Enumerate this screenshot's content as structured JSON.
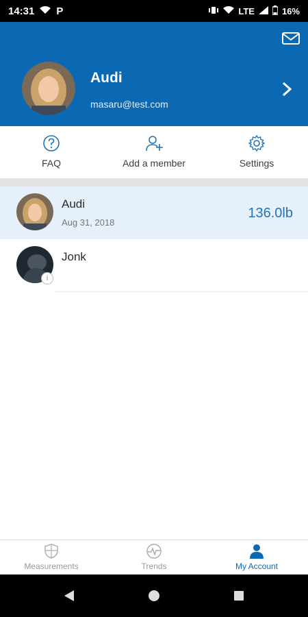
{
  "status_bar": {
    "time": "14:31",
    "network": "LTE",
    "battery": "16%",
    "p_label": "P"
  },
  "header": {
    "name": "Audi",
    "email": "masaru@test.com"
  },
  "actions": [
    {
      "label": "FAQ",
      "icon": "help-circle-icon"
    },
    {
      "label": "Add a member",
      "icon": "add-person-icon"
    },
    {
      "label": "Settings",
      "icon": "gear-icon"
    }
  ],
  "members": [
    {
      "name": "Audi",
      "date": "Aug 31, 2018",
      "weight": "136.0lb",
      "selected": true
    },
    {
      "name": "Jonk",
      "date": "",
      "weight": "",
      "selected": false
    }
  ],
  "bottom_nav": [
    {
      "label": "Measurements",
      "icon": "shield-icon",
      "active": false
    },
    {
      "label": "Trends",
      "icon": "pulse-icon",
      "active": false
    },
    {
      "label": "My Account",
      "icon": "person-icon",
      "active": true
    }
  ],
  "colors": {
    "primary": "#0b68b3",
    "selected_row": "#e6f0fa",
    "weight_text": "#1f73b7"
  }
}
